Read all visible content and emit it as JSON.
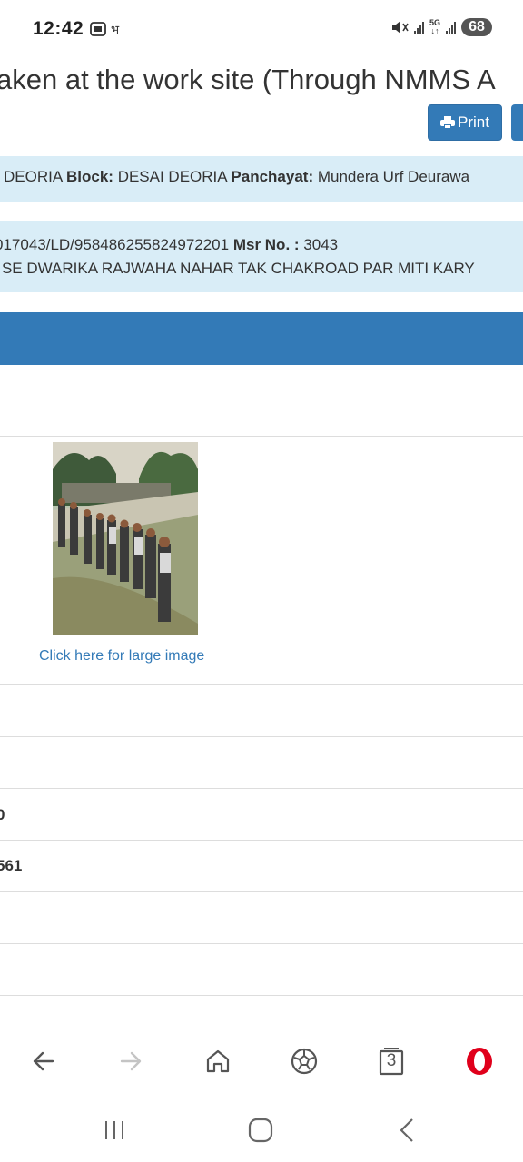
{
  "status": {
    "time": "12:42",
    "battery": "68",
    "network": "5G"
  },
  "page": {
    "title": "aken at the work site (Through NMMS A",
    "print_label": "Print",
    "location": {
      "district_value": "DEORIA",
      "block_label": "Block:",
      "block_value": "DESAI DEORIA",
      "panchayat_label": "Panchayat:",
      "panchayat_value": "Mundera Urf Deurawa"
    },
    "work": {
      "code_value": "017043/LD/958486255824972201",
      "msr_label": "Msr No. :",
      "msr_value": "3043",
      "name_value": "' SE DWARIKA RAJWAHA NAHAR TAK CHAKROAD PAR MITI KARY"
    },
    "photo_link": "Click here for large image",
    "cells": [
      "0",
      "561"
    ]
  },
  "browser": {
    "tab_count": "3",
    "icons": [
      "back-icon",
      "forward-icon",
      "home-icon",
      "football-icon",
      "tabs-icon",
      "opera-icon"
    ]
  },
  "system_nav": {
    "icons": [
      "recents-icon",
      "home-circle-icon",
      "back-chevron-icon"
    ]
  },
  "colors": {
    "primary": "#337ab7",
    "info_bg": "#d9edf7",
    "opera_red": "#e0001b"
  }
}
